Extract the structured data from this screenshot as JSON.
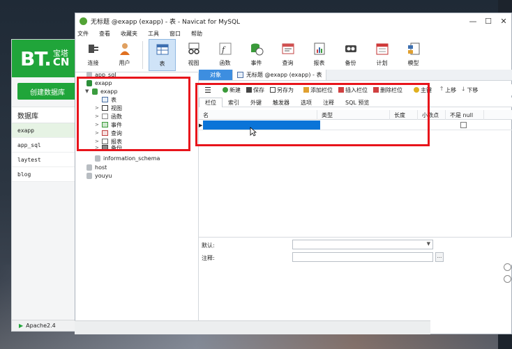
{
  "window": {
    "title": "无标题 @exapp (exapp) - 表 - Navicat for MySQL",
    "controls": [
      "—",
      "☐",
      "✕"
    ]
  },
  "menu": [
    "文件",
    "查看",
    "收藏夹",
    "工具",
    "窗口",
    "帮助"
  ],
  "toolbar": [
    {
      "label": "连接",
      "icon": "plug-icon"
    },
    {
      "label": "用户",
      "icon": "user-icon"
    },
    {
      "label": "表",
      "icon": "table-icon",
      "active": true
    },
    {
      "label": "视图",
      "icon": "glasses-icon"
    },
    {
      "label": "函数",
      "icon": "function-icon"
    },
    {
      "label": "事件",
      "icon": "event-icon"
    },
    {
      "label": "查询",
      "icon": "query-icon"
    },
    {
      "label": "报表",
      "icon": "report-icon"
    },
    {
      "label": "备份",
      "icon": "backup-icon"
    },
    {
      "label": "计划",
      "icon": "calendar-icon"
    },
    {
      "label": "模型",
      "icon": "model-icon"
    }
  ],
  "tree": {
    "items": [
      {
        "label": "app_sql",
        "level": 0
      },
      {
        "label": "exapp",
        "level": 0,
        "expanded": true
      },
      {
        "label": "exapp",
        "level": 1,
        "expanded": true
      },
      {
        "label": "表",
        "level": 2
      },
      {
        "label": "视图",
        "level": 2
      },
      {
        "label": "函数",
        "level": 2
      },
      {
        "label": "事件",
        "level": 2
      },
      {
        "label": "查询",
        "level": 2
      },
      {
        "label": "报表",
        "level": 2
      },
      {
        "label": "备份",
        "level": 2
      },
      {
        "label": "information_schema",
        "level": 1
      },
      {
        "label": "host",
        "level": 0
      },
      {
        "label": "youyu",
        "level": 0
      }
    ]
  },
  "tabs": {
    "objects": "对象",
    "document": "无标题 @exapp (exapp) - 表"
  },
  "subtoolbar": [
    "新建",
    "保存",
    "另存为",
    "添加栏位",
    "插入栏位",
    "删除栏位",
    "主键",
    "上移",
    "下移"
  ],
  "field_tabs": [
    "栏位",
    "索引",
    "外键",
    "触发器",
    "选项",
    "注释",
    "SQL 预览"
  ],
  "grid": {
    "columns": [
      "名",
      "类型",
      "长度",
      "小数点",
      "不是 null"
    ]
  },
  "properties": {
    "default_label": "默认:",
    "comment_label": "注释:",
    "ellipsis": "..."
  },
  "bt": {
    "logo_main": "BT.",
    "logo_zh": "宝塔",
    "logo_en": "CN",
    "create_db": "创建数据库",
    "db_header": "数据库",
    "databases": [
      "exapp",
      "app_sql",
      "laytest",
      "blog"
    ],
    "footer": "Apache2.4"
  },
  "colors": {
    "accent": "#3d8ee0",
    "selection": "#0a74d8",
    "annotation": "#e8141b",
    "bt_green": "#20a53a"
  }
}
